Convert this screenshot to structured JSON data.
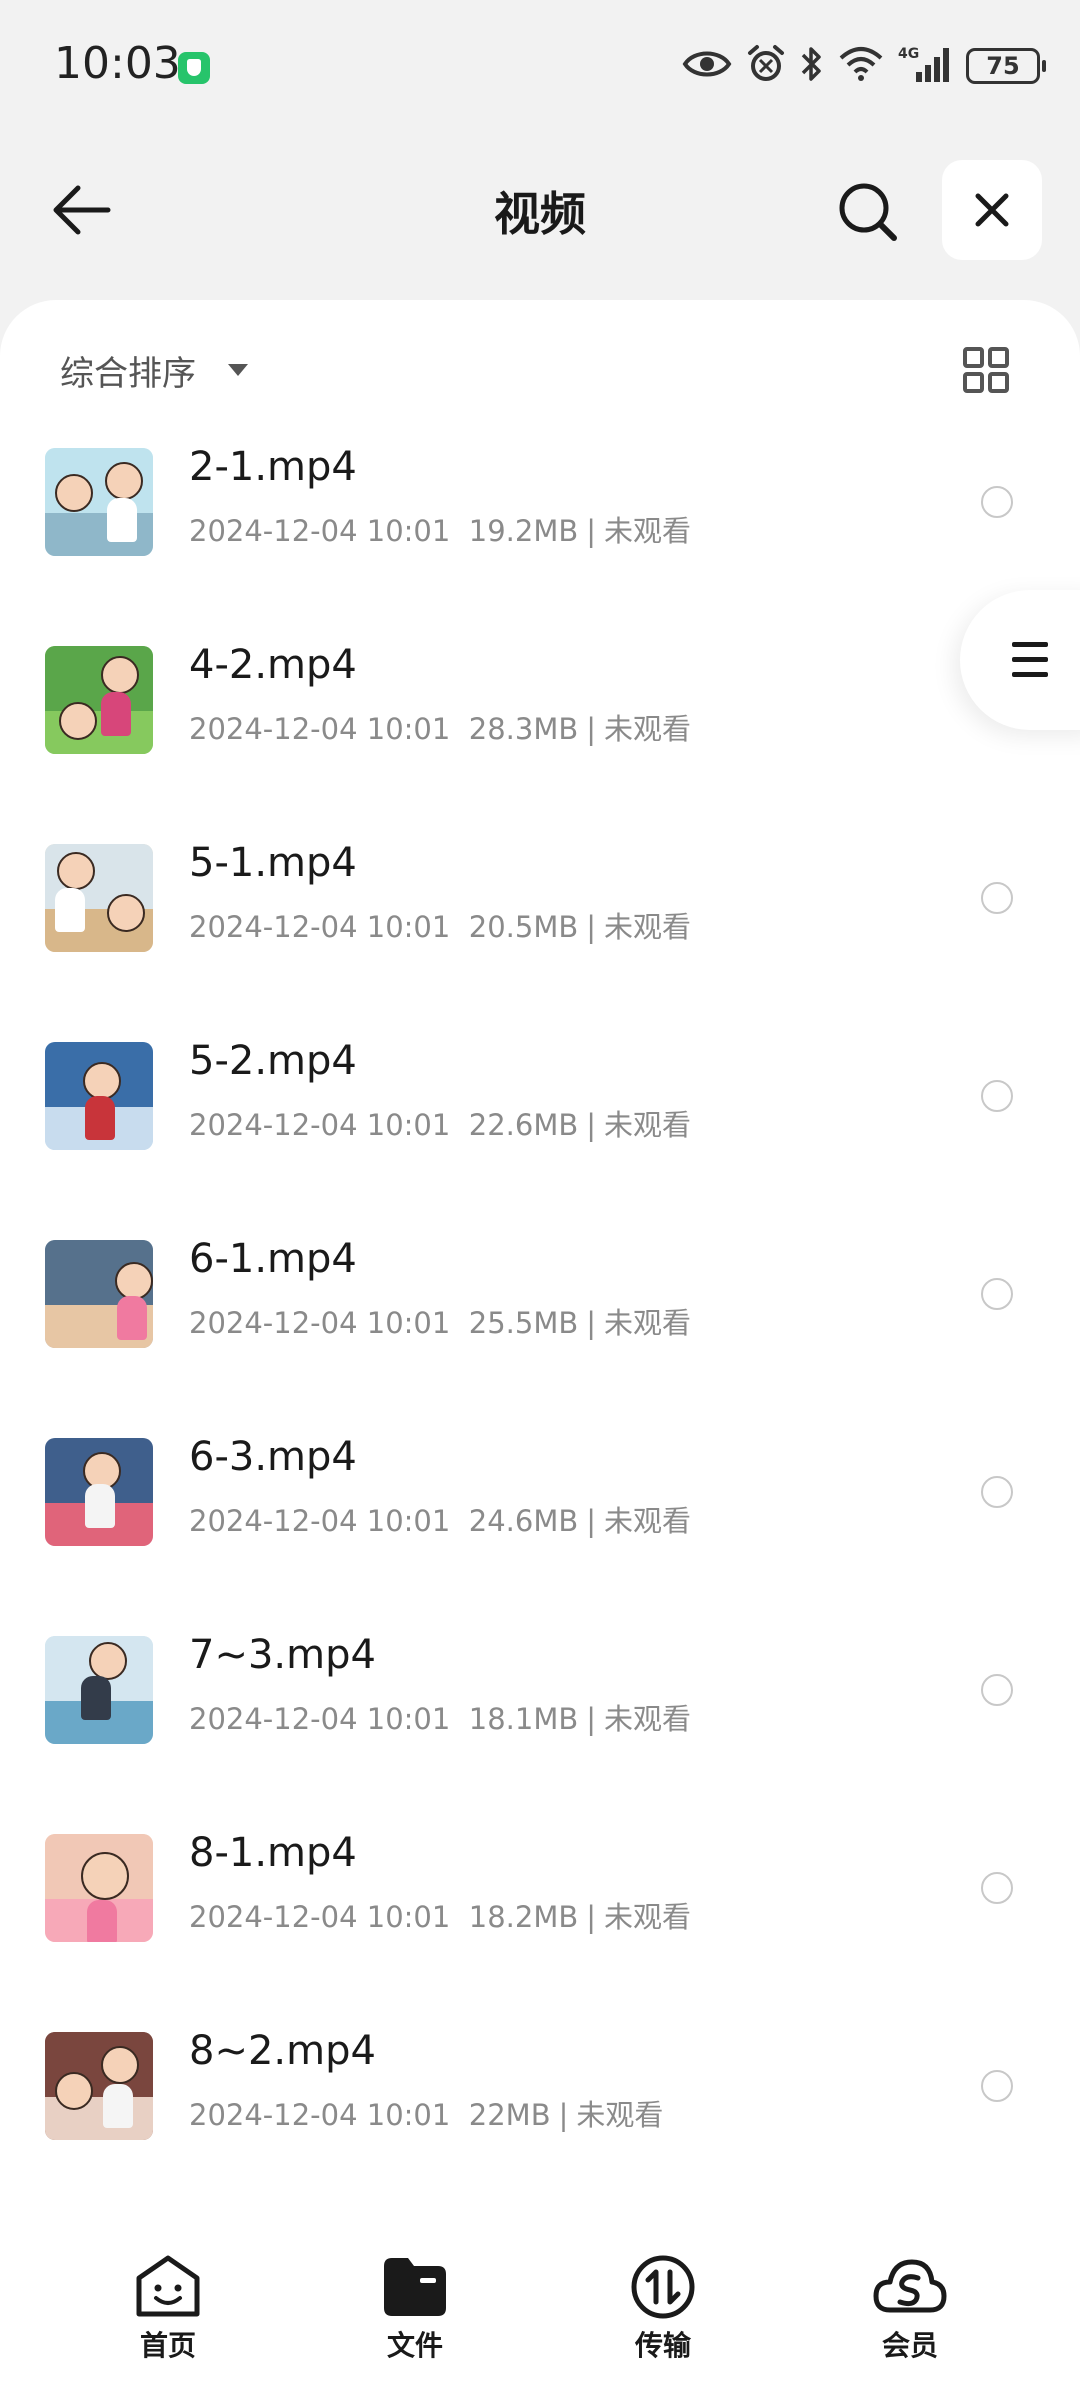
{
  "status_bar": {
    "time": "10:03",
    "battery": "75",
    "network": "4G",
    "icons": [
      "eye-icon",
      "alarm-icon",
      "bluetooth-icon",
      "wifi-icon",
      "signal-icon",
      "battery-icon"
    ]
  },
  "header": {
    "title": "视频",
    "back_icon": "arrow-left-icon",
    "search_icon": "search-icon",
    "close_icon": "close-icon"
  },
  "toolbar": {
    "sort_label": "综合排序",
    "view_icon": "grid-view-icon"
  },
  "files": [
    {
      "name": "2-1.mp4",
      "date": "2024-12-04 10:01",
      "size": "19.2MB",
      "status": "未观看"
    },
    {
      "name": "4-2.mp4",
      "date": "2024-12-04 10:01",
      "size": "28.3MB",
      "status": "未观看"
    },
    {
      "name": "5-1.mp4",
      "date": "2024-12-04 10:01",
      "size": "20.5MB",
      "status": "未观看"
    },
    {
      "name": "5-2.mp4",
      "date": "2024-12-04 10:01",
      "size": "22.6MB",
      "status": "未观看"
    },
    {
      "name": "6-1.mp4",
      "date": "2024-12-04 10:01",
      "size": "25.5MB",
      "status": "未观看"
    },
    {
      "name": "6-3.mp4",
      "date": "2024-12-04 10:01",
      "size": "24.6MB",
      "status": "未观看"
    },
    {
      "name": "7~3.mp4",
      "date": "2024-12-04 10:01",
      "size": "18.1MB",
      "status": "未观看"
    },
    {
      "name": "8-1.mp4",
      "date": "2024-12-04 10:01",
      "size": "18.2MB",
      "status": "未观看"
    },
    {
      "name": "8~2.mp4",
      "date": "2024-12-04 10:01",
      "size": "22MB",
      "status": "未观看"
    }
  ],
  "nav": [
    {
      "label": "首页",
      "icon": "smiley-home-icon"
    },
    {
      "label": "文件",
      "icon": "folder-icon"
    },
    {
      "label": "传输",
      "icon": "transfer-icon"
    },
    {
      "label": "会员",
      "icon": "cloud-member-icon"
    }
  ],
  "colors": {
    "background": "#f2f2f2",
    "panel": "#ffffff",
    "accent_green": "#27c46b",
    "meta_text": "#8a8a8a"
  }
}
